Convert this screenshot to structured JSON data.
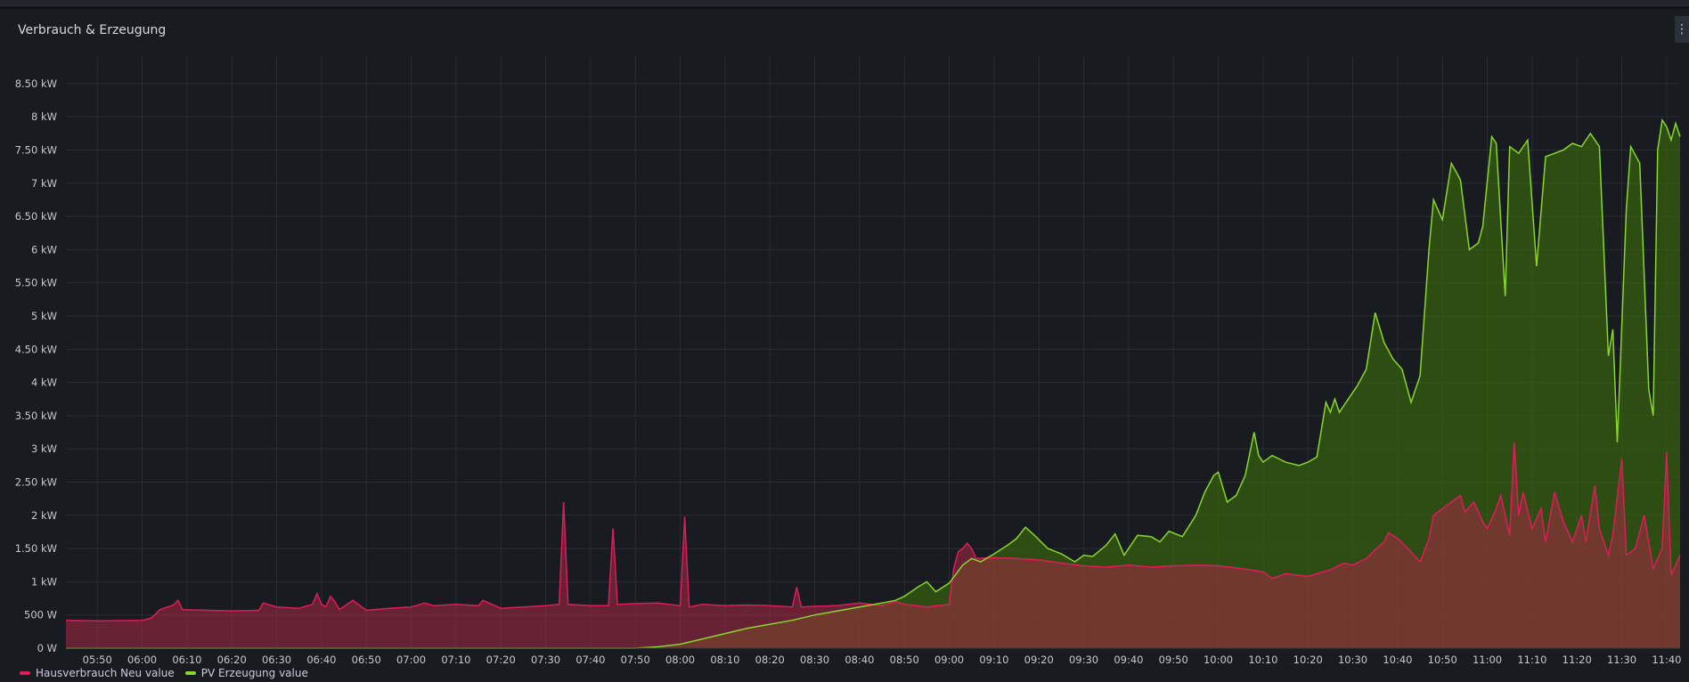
{
  "panel": {
    "title": "Verbrauch & Erzeugung",
    "menu_icon": "kebab-menu-icon"
  },
  "colors": {
    "house": "#e01b5c",
    "house_fill": "rgba(120,18,60,0.75)",
    "pv": "#8ad52f",
    "pv_fill": "rgba(58,105,12,0.65)",
    "overlap_line": "#e0503a"
  },
  "chart_data": {
    "type": "area",
    "title": "Verbrauch & Erzeugung",
    "xlabel": "",
    "ylabel": "",
    "ylim": [
      0,
      8.9
    ],
    "y_ticks": [
      {
        "v": 0,
        "label": "0 W"
      },
      {
        "v": 0.5,
        "label": "500 W"
      },
      {
        "v": 1,
        "label": "1 kW"
      },
      {
        "v": 1.5,
        "label": "1.50 kW"
      },
      {
        "v": 2,
        "label": "2 kW"
      },
      {
        "v": 2.5,
        "label": "2.50 kW"
      },
      {
        "v": 3,
        "label": "3 kW"
      },
      {
        "v": 3.5,
        "label": "3.50 kW"
      },
      {
        "v": 4,
        "label": "4 kW"
      },
      {
        "v": 4.5,
        "label": "4.50 kW"
      },
      {
        "v": 5,
        "label": "5 kW"
      },
      {
        "v": 5.5,
        "label": "5.50 kW"
      },
      {
        "v": 6,
        "label": "6 kW"
      },
      {
        "v": 6.5,
        "label": "6.50 kW"
      },
      {
        "v": 7,
        "label": "7 kW"
      },
      {
        "v": 7.5,
        "label": "7.50 kW"
      },
      {
        "v": 8,
        "label": "8 kW"
      },
      {
        "v": 8.5,
        "label": "8.50 kW"
      }
    ],
    "xlim": [
      "05:43",
      "11:43"
    ],
    "x_ticks": [
      "05:50",
      "06:00",
      "06:10",
      "06:20",
      "06:30",
      "06:40",
      "06:50",
      "07:00",
      "07:10",
      "07:20",
      "07:30",
      "07:40",
      "07:50",
      "08:00",
      "08:10",
      "08:20",
      "08:30",
      "08:40",
      "08:50",
      "09:00",
      "09:10",
      "09:20",
      "09:30",
      "09:40",
      "09:50",
      "10:00",
      "10:10",
      "10:20",
      "10:30",
      "10:40",
      "10:50",
      "11:00",
      "11:10",
      "11:20",
      "11:30",
      "11:40"
    ],
    "series": [
      {
        "name": "Hausverbrauch Neu value",
        "unit": "kW",
        "points": [
          [
            "05:43",
            0.42
          ],
          [
            "05:50",
            0.41
          ],
          [
            "06:00",
            0.42
          ],
          [
            "06:02",
            0.45
          ],
          [
            "06:04",
            0.58
          ],
          [
            "06:07",
            0.65
          ],
          [
            "06:08",
            0.72
          ],
          [
            "06:09",
            0.58
          ],
          [
            "06:15",
            0.57
          ],
          [
            "06:20",
            0.56
          ],
          [
            "06:26",
            0.57
          ],
          [
            "06:27",
            0.68
          ],
          [
            "06:30",
            0.62
          ],
          [
            "06:35",
            0.6
          ],
          [
            "06:38",
            0.66
          ],
          [
            "06:39",
            0.82
          ],
          [
            "06:40",
            0.66
          ],
          [
            "06:41",
            0.62
          ],
          [
            "06:42",
            0.78
          ],
          [
            "06:43",
            0.7
          ],
          [
            "06:44",
            0.58
          ],
          [
            "06:47",
            0.72
          ],
          [
            "06:50",
            0.57
          ],
          [
            "06:55",
            0.6
          ],
          [
            "07:00",
            0.62
          ],
          [
            "07:03",
            0.68
          ],
          [
            "07:05",
            0.64
          ],
          [
            "07:10",
            0.66
          ],
          [
            "07:15",
            0.64
          ],
          [
            "07:16",
            0.72
          ],
          [
            "07:20",
            0.6
          ],
          [
            "07:25",
            0.62
          ],
          [
            "07:30",
            0.64
          ],
          [
            "07:33",
            0.66
          ],
          [
            "07:34",
            2.2
          ],
          [
            "07:35",
            0.66
          ],
          [
            "07:40",
            0.64
          ],
          [
            "07:44",
            0.64
          ],
          [
            "07:45",
            1.8
          ],
          [
            "07:46",
            0.66
          ],
          [
            "07:50",
            0.67
          ],
          [
            "07:55",
            0.68
          ],
          [
            "08:00",
            0.64
          ],
          [
            "08:01",
            1.98
          ],
          [
            "08:02",
            0.62
          ],
          [
            "08:05",
            0.66
          ],
          [
            "08:10",
            0.64
          ],
          [
            "08:15",
            0.65
          ],
          [
            "08:20",
            0.64
          ],
          [
            "08:25",
            0.62
          ],
          [
            "08:26",
            0.92
          ],
          [
            "08:27",
            0.62
          ],
          [
            "08:30",
            0.63
          ],
          [
            "08:35",
            0.64
          ],
          [
            "08:40",
            0.68
          ],
          [
            "08:45",
            0.64
          ],
          [
            "08:48",
            0.7
          ],
          [
            "08:50",
            0.66
          ],
          [
            "08:55",
            0.62
          ],
          [
            "09:00",
            0.66
          ],
          [
            "09:01",
            1.2
          ],
          [
            "09:02",
            1.45
          ],
          [
            "09:03",
            1.5
          ],
          [
            "09:04",
            1.58
          ],
          [
            "09:05",
            1.5
          ],
          [
            "09:06",
            1.35
          ],
          [
            "09:10",
            1.36
          ],
          [
            "09:15",
            1.35
          ],
          [
            "09:20",
            1.33
          ],
          [
            "09:25",
            1.28
          ],
          [
            "09:30",
            1.24
          ],
          [
            "09:35",
            1.22
          ],
          [
            "09:40",
            1.25
          ],
          [
            "09:45",
            1.22
          ],
          [
            "09:50",
            1.24
          ],
          [
            "09:55",
            1.25
          ],
          [
            "10:00",
            1.24
          ],
          [
            "10:05",
            1.2
          ],
          [
            "10:10",
            1.15
          ],
          [
            "10:12",
            1.05
          ],
          [
            "10:15",
            1.12
          ],
          [
            "10:20",
            1.08
          ],
          [
            "10:25",
            1.18
          ],
          [
            "10:28",
            1.28
          ],
          [
            "10:30",
            1.25
          ],
          [
            "10:33",
            1.35
          ],
          [
            "10:35",
            1.48
          ],
          [
            "10:37",
            1.6
          ],
          [
            "10:38",
            1.74
          ],
          [
            "10:40",
            1.65
          ],
          [
            "10:42",
            1.52
          ],
          [
            "10:45",
            1.3
          ],
          [
            "10:47",
            1.64
          ],
          [
            "10:48",
            2.0
          ],
          [
            "10:50",
            2.1
          ],
          [
            "10:52",
            2.2
          ],
          [
            "10:54",
            2.3
          ],
          [
            "10:55",
            2.05
          ],
          [
            "10:57",
            2.2
          ],
          [
            "10:59",
            1.9
          ],
          [
            "11:00",
            1.8
          ],
          [
            "11:02",
            2.1
          ],
          [
            "11:03",
            2.3
          ],
          [
            "11:05",
            1.7
          ],
          [
            "11:06",
            3.1
          ],
          [
            "11:07",
            2.0
          ],
          [
            "11:08",
            2.35
          ],
          [
            "11:10",
            1.8
          ],
          [
            "11:12",
            2.1
          ],
          [
            "11:13",
            1.6
          ],
          [
            "11:15",
            2.35
          ],
          [
            "11:17",
            1.9
          ],
          [
            "11:19",
            1.6
          ],
          [
            "11:21",
            2.0
          ],
          [
            "11:22",
            1.6
          ],
          [
            "11:24",
            2.45
          ],
          [
            "11:25",
            1.8
          ],
          [
            "11:27",
            1.4
          ],
          [
            "11:28",
            1.7
          ],
          [
            "11:30",
            2.85
          ],
          [
            "11:31",
            1.4
          ],
          [
            "11:33",
            1.5
          ],
          [
            "11:35",
            2.0
          ],
          [
            "11:37",
            1.2
          ],
          [
            "11:39",
            1.5
          ],
          [
            "11:40",
            2.95
          ],
          [
            "11:41",
            1.1
          ],
          [
            "11:43",
            1.4
          ]
        ]
      },
      {
        "name": "PV Erzeugung value",
        "unit": "kW",
        "points": [
          [
            "05:43",
            0.0
          ],
          [
            "07:50",
            0.0
          ],
          [
            "07:55",
            0.02
          ],
          [
            "08:00",
            0.06
          ],
          [
            "08:05",
            0.14
          ],
          [
            "08:10",
            0.22
          ],
          [
            "08:15",
            0.3
          ],
          [
            "08:20",
            0.36
          ],
          [
            "08:25",
            0.42
          ],
          [
            "08:30",
            0.5
          ],
          [
            "08:35",
            0.56
          ],
          [
            "08:40",
            0.62
          ],
          [
            "08:45",
            0.68
          ],
          [
            "08:48",
            0.72
          ],
          [
            "08:50",
            0.78
          ],
          [
            "08:53",
            0.92
          ],
          [
            "08:55",
            1.0
          ],
          [
            "08:57",
            0.85
          ],
          [
            "09:00",
            0.98
          ],
          [
            "09:03",
            1.25
          ],
          [
            "09:05",
            1.35
          ],
          [
            "09:07",
            1.3
          ],
          [
            "09:10",
            1.42
          ],
          [
            "09:13",
            1.55
          ],
          [
            "09:15",
            1.65
          ],
          [
            "09:17",
            1.82
          ],
          [
            "09:19",
            1.7
          ],
          [
            "09:22",
            1.5
          ],
          [
            "09:25",
            1.42
          ],
          [
            "09:28",
            1.3
          ],
          [
            "09:30",
            1.4
          ],
          [
            "09:32",
            1.38
          ],
          [
            "09:35",
            1.55
          ],
          [
            "09:37",
            1.72
          ],
          [
            "09:39",
            1.4
          ],
          [
            "09:42",
            1.7
          ],
          [
            "09:45",
            1.68
          ],
          [
            "09:47",
            1.6
          ],
          [
            "09:49",
            1.76
          ],
          [
            "09:52",
            1.68
          ],
          [
            "09:55",
            2.0
          ],
          [
            "09:57",
            2.35
          ],
          [
            "09:59",
            2.6
          ],
          [
            "10:00",
            2.65
          ],
          [
            "10:02",
            2.2
          ],
          [
            "10:04",
            2.3
          ],
          [
            "10:06",
            2.6
          ],
          [
            "10:08",
            3.25
          ],
          [
            "10:09",
            2.9
          ],
          [
            "10:10",
            2.8
          ],
          [
            "10:12",
            2.9
          ],
          [
            "10:15",
            2.8
          ],
          [
            "10:18",
            2.75
          ],
          [
            "10:20",
            2.8
          ],
          [
            "10:22",
            2.88
          ],
          [
            "10:24",
            3.7
          ],
          [
            "10:25",
            3.55
          ],
          [
            "10:26",
            3.75
          ],
          [
            "10:27",
            3.55
          ],
          [
            "10:29",
            3.75
          ],
          [
            "10:31",
            3.95
          ],
          [
            "10:33",
            4.2
          ],
          [
            "10:35",
            5.05
          ],
          [
            "10:37",
            4.6
          ],
          [
            "10:39",
            4.35
          ],
          [
            "10:41",
            4.2
          ],
          [
            "10:43",
            3.7
          ],
          [
            "10:45",
            4.1
          ],
          [
            "10:47",
            6.0
          ],
          [
            "10:48",
            6.75
          ],
          [
            "10:50",
            6.45
          ],
          [
            "10:52",
            7.3
          ],
          [
            "10:54",
            7.05
          ],
          [
            "10:56",
            6.0
          ],
          [
            "10:58",
            6.1
          ],
          [
            "10:59",
            6.35
          ],
          [
            "11:01",
            7.7
          ],
          [
            "11:02",
            7.6
          ],
          [
            "11:04",
            5.3
          ],
          [
            "11:05",
            7.55
          ],
          [
            "11:07",
            7.45
          ],
          [
            "11:09",
            7.65
          ],
          [
            "11:11",
            5.75
          ],
          [
            "11:13",
            7.4
          ],
          [
            "11:15",
            7.45
          ],
          [
            "11:17",
            7.5
          ],
          [
            "11:19",
            7.6
          ],
          [
            "11:21",
            7.55
          ],
          [
            "11:23",
            7.75
          ],
          [
            "11:25",
            7.55
          ],
          [
            "11:27",
            4.4
          ],
          [
            "11:28",
            4.8
          ],
          [
            "11:29",
            3.1
          ],
          [
            "11:31",
            6.6
          ],
          [
            "11:32",
            7.55
          ],
          [
            "11:34",
            7.3
          ],
          [
            "11:36",
            3.9
          ],
          [
            "11:37",
            3.5
          ],
          [
            "11:38",
            7.5
          ],
          [
            "11:39",
            7.95
          ],
          [
            "11:40",
            7.85
          ],
          [
            "11:41",
            7.65
          ],
          [
            "11:42",
            7.9
          ],
          [
            "11:43",
            7.7
          ]
        ]
      }
    ],
    "legend": {
      "position": "bottom-left",
      "items": [
        "Hausverbrauch Neu value",
        "PV Erzeugung value"
      ]
    },
    "grid": true
  }
}
